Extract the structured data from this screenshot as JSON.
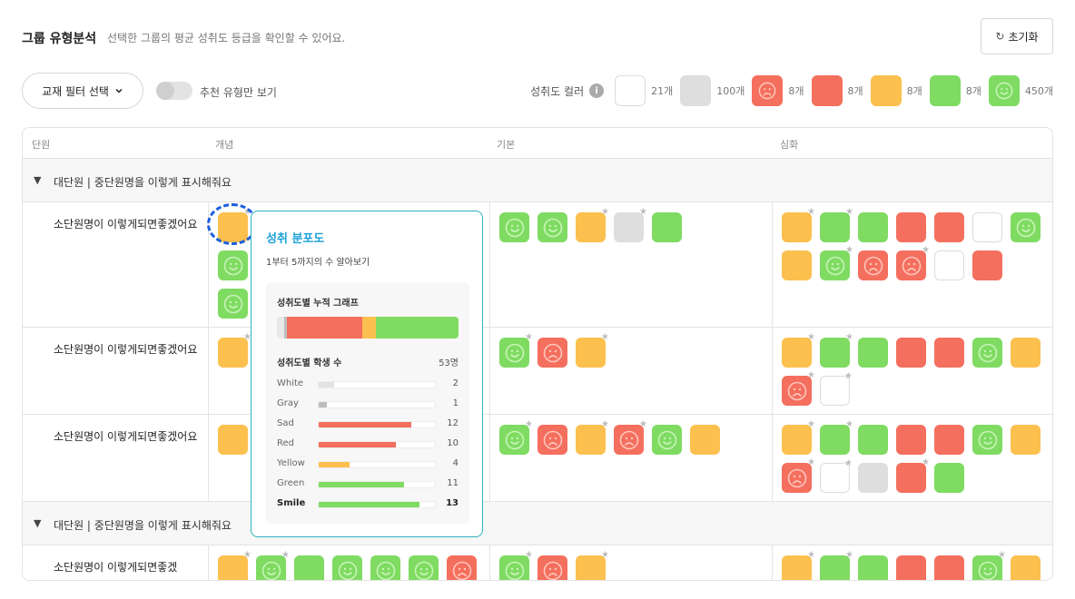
{
  "header": {
    "title": "그룹 유형분석",
    "subtitle": "선택한 그룹의 평균 성취도 등급을 확인할 수 있어요.",
    "reset_label": "초기화"
  },
  "filters": {
    "textbook_filter_label": "교재 필터 선택",
    "recommended_only_label": "추천 유형만 보기",
    "recommended_only": false
  },
  "legend": {
    "label": "성취도 컬러",
    "info_icon": "i",
    "items": [
      {
        "type": "white",
        "count": "21개"
      },
      {
        "type": "gray",
        "count": "100개"
      },
      {
        "type": "sad",
        "count": "8개"
      },
      {
        "type": "red",
        "count": "8개"
      },
      {
        "type": "yellow",
        "count": "8개"
      },
      {
        "type": "green",
        "count": "8개"
      },
      {
        "type": "smile",
        "count": "450개"
      }
    ]
  },
  "colors": {
    "white": "#ffffff",
    "gray": "#dedede",
    "sad": "#f46f5e",
    "red": "#f46f5e",
    "yellow": "#fcc04f",
    "green": "#7fdb62",
    "smile": "#7fdb62",
    "accent": "#1aa0d6"
  },
  "table": {
    "headers": {
      "unit": "단원",
      "concept": "개념",
      "basic": "기본",
      "advanced": "심화"
    },
    "sections": [
      {
        "title": "대단원 | 중단원명을 이렇게 표시해줘요",
        "rows": [
          {
            "unit": "소단원명이 이렇게되면좋겠어요",
            "concept": [
              [
                "yellow",
                true
              ],
              [
                "smile",
                false
              ],
              [
                "smile",
                false
              ]
            ],
            "basic": [
              [
                "smile",
                false
              ],
              [
                "smile",
                false
              ],
              [
                "yellow",
                true
              ],
              [
                "gray",
                true
              ],
              [
                "green",
                false
              ]
            ],
            "advanced": [
              [
                "yellow",
                true
              ],
              [
                "green",
                true
              ],
              [
                "green",
                false
              ],
              [
                "red",
                false
              ],
              [
                "red",
                false
              ],
              [
                "white",
                false
              ],
              [
                "smile",
                false
              ],
              [
                "yellow",
                false
              ],
              [
                "smile",
                true
              ],
              [
                "sad",
                false
              ],
              [
                "sad",
                true
              ],
              [
                "white",
                false
              ],
              [
                "red",
                false
              ]
            ]
          },
          {
            "unit": "소단원명이 이렇게되면좋겠어요",
            "concept": [
              [
                "yellow",
                true
              ],
              [
                "white",
                false
              ]
            ],
            "basic": [
              [
                "smile",
                true
              ],
              [
                "sad",
                false
              ],
              [
                "yellow",
                true
              ]
            ],
            "advanced": [
              [
                "yellow",
                true
              ],
              [
                "green",
                true
              ],
              [
                "green",
                false
              ],
              [
                "red",
                false
              ],
              [
                "red",
                false
              ],
              [
                "smile",
                false
              ],
              [
                "yellow",
                false
              ],
              [
                "sad",
                true
              ],
              [
                "white",
                true
              ]
            ]
          },
          {
            "unit": "소단원명이 이렇게되면좋겠어요",
            "concept": [
              [
                "yellow",
                false
              ]
            ],
            "basic": [
              [
                "smile",
                true
              ],
              [
                "sad",
                false
              ],
              [
                "yellow",
                true
              ],
              [
                "sad",
                true
              ],
              [
                "smile",
                false
              ],
              [
                "yellow",
                false
              ]
            ],
            "advanced": [
              [
                "yellow",
                true
              ],
              [
                "green",
                true
              ],
              [
                "green",
                false
              ],
              [
                "red",
                false
              ],
              [
                "red",
                false
              ],
              [
                "smile",
                false
              ],
              [
                "yellow",
                false
              ],
              [
                "sad",
                true
              ],
              [
                "white",
                true
              ],
              [
                "gray",
                false
              ],
              [
                "red",
                true
              ],
              [
                "green",
                false
              ]
            ]
          }
        ]
      },
      {
        "title": "대단원 | 중단원명을 이렇게 표시해줘요",
        "rows": [
          {
            "unit": "소단원명이 이렇게되면좋겠",
            "concept": [
              [
                "yellow",
                true
              ],
              [
                "smile",
                true
              ],
              [
                "green",
                false
              ],
              [
                "smile",
                false
              ],
              [
                "smile",
                false
              ],
              [
                "smile",
                false
              ],
              [
                "sad",
                false
              ]
            ],
            "basic": [
              [
                "smile",
                true
              ],
              [
                "sad",
                false
              ],
              [
                "yellow",
                true
              ]
            ],
            "advanced": [
              [
                "yellow",
                true
              ],
              [
                "green",
                true
              ],
              [
                "green",
                false
              ],
              [
                "red",
                false
              ],
              [
                "red",
                false
              ],
              [
                "smile",
                true
              ],
              [
                "yellow",
                false
              ]
            ]
          }
        ]
      }
    ]
  },
  "popover": {
    "title": "성취 분포도",
    "subtitle": "1부터 5까지의 수 알아보기",
    "stack_title": "성취도별 누적 그래프",
    "count_title": "성취도별 학생 수",
    "total": "53명",
    "distribution": [
      {
        "label": "White",
        "value": 2,
        "type": "white"
      },
      {
        "label": "Gray",
        "value": 1,
        "type": "gray"
      },
      {
        "label": "Sad",
        "value": 12,
        "type": "sad"
      },
      {
        "label": "Red",
        "value": 10,
        "type": "red"
      },
      {
        "label": "Yellow",
        "value": 4,
        "type": "yellow"
      },
      {
        "label": "Green",
        "value": 11,
        "type": "green"
      },
      {
        "label": "Smile",
        "value": 13,
        "type": "smile"
      }
    ],
    "max_value": 15
  }
}
